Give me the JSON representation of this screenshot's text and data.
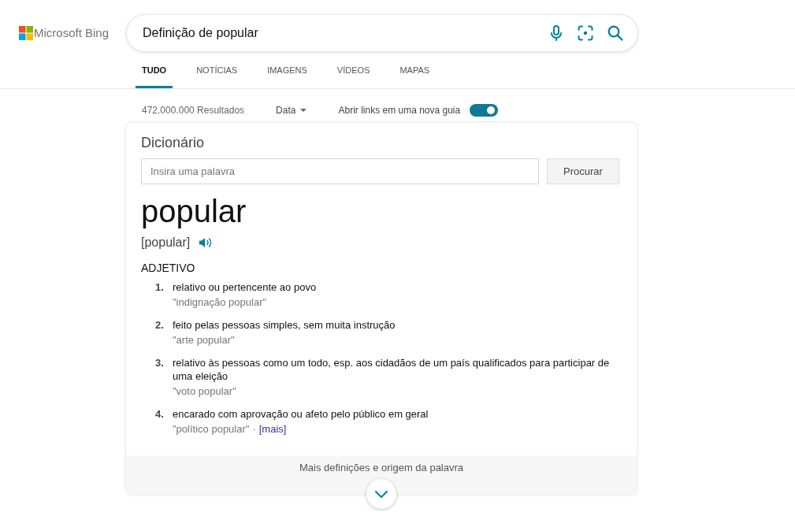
{
  "header": {
    "logo_text": "Microsoft Bing",
    "search": {
      "value": "Definição de popular"
    }
  },
  "tabs": [
    {
      "label": "TUDO",
      "selected": true
    },
    {
      "label": "NOTÍCIAS",
      "selected": false
    },
    {
      "label": "IMAGENS",
      "selected": false
    },
    {
      "label": "VÍDEOS",
      "selected": false
    },
    {
      "label": "MAPAS",
      "selected": false
    }
  ],
  "toolbar": {
    "results_count": "472.000.000 Resultados",
    "date_filter": "Data",
    "new_tab_toggle": {
      "label": "Abrir links em uma nova guia",
      "on": true
    }
  },
  "dictionary": {
    "title": "Dicionário",
    "search": {
      "placeholder": "Insira uma palavra"
    },
    "search_button": "Procurar",
    "word": "popular",
    "pronunciation": "[popular]",
    "part_of_speech": "ADJETIVO",
    "definitions": [
      {
        "number": "1.",
        "text": "relativo ou pertencente ao povo",
        "example": "\"indignação popular\""
      },
      {
        "number": "2.",
        "text": "feito pelas pessoas simples, sem muita instrução",
        "example": "\"arte popular\""
      },
      {
        "number": "3.",
        "text": "relativo às pessoas como um todo, esp. aos cidadãos de um país qualificados para participar de uma eleição",
        "example": "\"voto popular\""
      },
      {
        "number": "4.",
        "text": "encarado com aprovação ou afeto pelo público em geral",
        "example": "\"político popular\"",
        "separator": "·",
        "more_link": "[mais]"
      }
    ],
    "footer": "Mais definições e origem da palavra"
  }
}
